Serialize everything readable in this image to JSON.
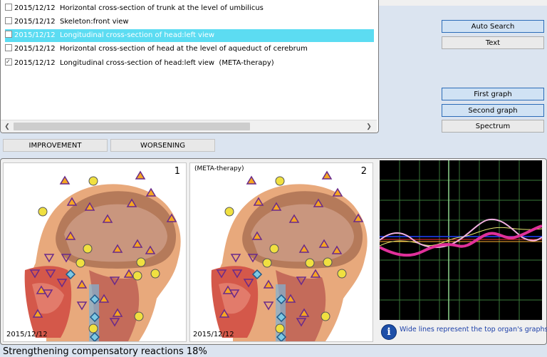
{
  "records": [
    {
      "date": "2015/12/12",
      "title": "Horizontal cross-section of trunk at the level of umbilicus",
      "checked": false,
      "selected": false
    },
    {
      "date": "2015/12/12",
      "title": "Skeleton:front view",
      "checked": false,
      "selected": false
    },
    {
      "date": "2015/12/12",
      "title": "Longitudinal cross-section of head:left view",
      "checked": false,
      "selected": true
    },
    {
      "date": "2015/12/12",
      "title": "Horizontal cross-section of head at the level of aqueduct of cerebrum",
      "checked": false,
      "selected": false
    },
    {
      "date": "2015/12/12",
      "title": "Longitudinal cross-section of head:left view  (META-therapy)",
      "checked": true,
      "selected": false
    }
  ],
  "buttons": {
    "auto_search": "Auto Search",
    "text": "Text",
    "first_graph": "First graph",
    "second_graph": "Second graph",
    "spectrum": "Spectrum",
    "improvement": "IMPROVEMENT",
    "worsening": "WORSENING"
  },
  "panel1": {
    "number": "1",
    "date": "2015/12/12"
  },
  "panel2": {
    "number": "2",
    "date": "2015/12/12",
    "tag": "(META-therapy)"
  },
  "info": {
    "text": "Wide lines represent the top organ's graphs",
    "icon": "info-icon"
  },
  "status": {
    "text": "Strengthening compensatory reactions 18%"
  },
  "colors": {
    "selection": "#5cdcf2",
    "graph_bg": "#000000",
    "wide_line": "#e0309a",
    "info_text": "#1c3fa8"
  }
}
